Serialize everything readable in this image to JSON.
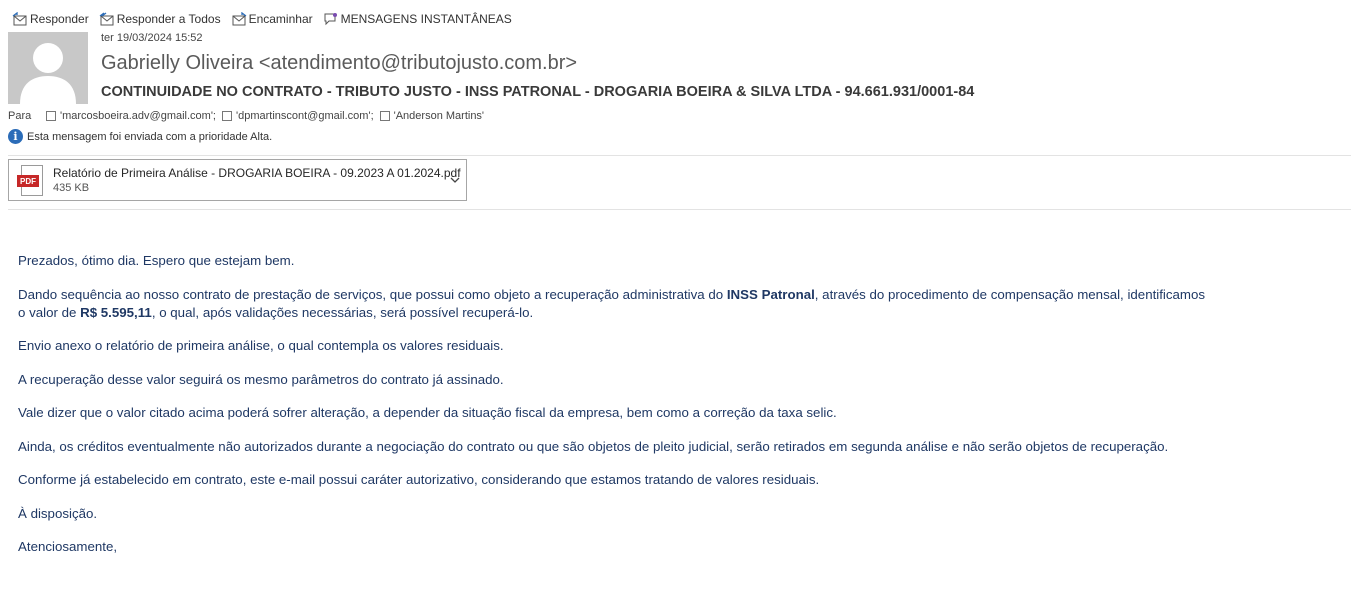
{
  "toolbar": {
    "reply": "Responder",
    "reply_all": "Responder a Todos",
    "forward": "Encaminhar",
    "im": "MENSAGENS INSTANTÂNEAS"
  },
  "header": {
    "date": "ter 19/03/2024 15:52",
    "sender": "Gabrielly Oliveira <atendimento@tributojusto.com.br>",
    "subject": "CONTINUIDADE NO CONTRATO - TRIBUTO JUSTO - INSS PATRONAL - DROGARIA BOEIRA & SILVA LTDA - 94.661.931/0001-84",
    "to_label": "Para",
    "recipients": [
      "'marcosboeira.adv@gmail.com';",
      "'dpmartinscont@gmail.com';",
      "'Anderson Martins'"
    ],
    "priority_notice": "Esta mensagem foi enviada com a prioridade Alta."
  },
  "attachment": {
    "name": "Relatório de Primeira Análise - DROGARIA BOEIRA - 09.2023 A 01.2024.pdf",
    "size": "435 KB",
    "type_label": "PDF"
  },
  "body": {
    "p1": "Prezados, ótimo dia. Espero que estejam bem.",
    "p2_a": "Dando sequência ao nosso contrato de prestação de serviços, que possui como objeto a recuperação administrativa do ",
    "p2_b": "INSS Patronal",
    "p2_c": ", através do procedimento de compensação mensal, identificamos",
    "p2_d": "o valor de ",
    "p2_e": "R$ 5.595,11",
    "p2_f": ", o qual, após validações necessárias, será possível recuperá-lo.",
    "p3": "Envio anexo o relatório de primeira análise, o qual contempla os valores residuais.",
    "p4": "A recuperação desse valor seguirá os mesmo parâmetros do contrato já assinado.",
    "p5": "Vale dizer que o valor citado acima poderá sofrer alteração, a depender da situação fiscal da empresa, bem como a correção da taxa selic.",
    "p6": "Ainda, os créditos eventualmente não autorizados durante a negociação do contrato ou que são objetos de pleito judicial, serão retirados em segunda análise e não serão objetos de recuperação.",
    "p7": "Conforme já estabelecido em contrato, este e-mail possui caráter autorizativo, considerando que estamos tratando de valores residuais.",
    "p8": "À disposição.",
    "p9": "Atenciosamente,"
  },
  "colors": {
    "body_text": "#1f3864",
    "priority_icon": "#2b6cb8",
    "pdf_badge": "#c62828"
  }
}
